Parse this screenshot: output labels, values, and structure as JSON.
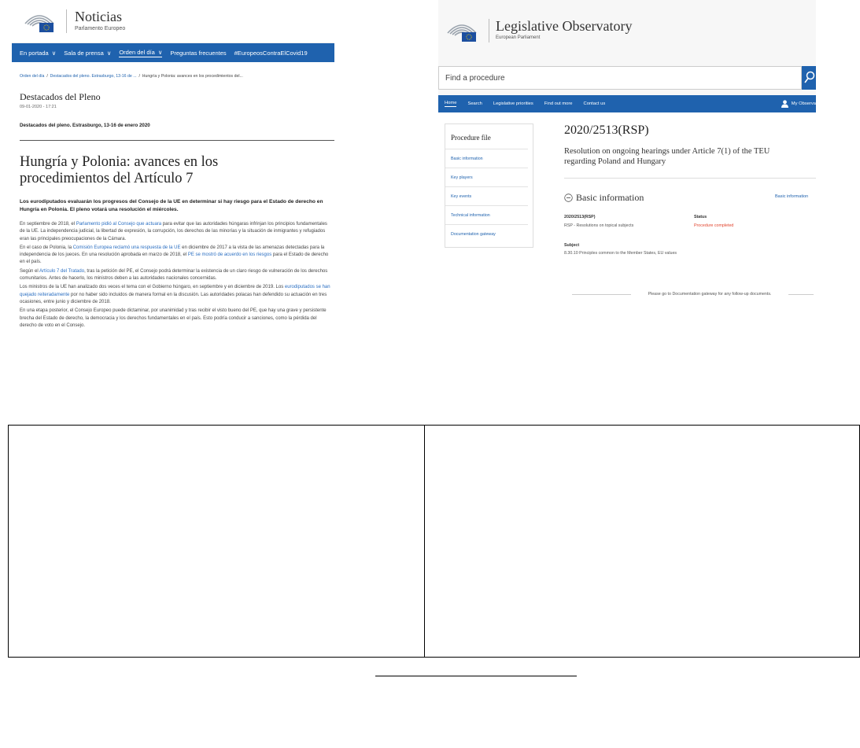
{
  "left_panel": {
    "brand_title": "Noticias",
    "brand_subtitle": "Parlamento Europeo",
    "nav": [
      {
        "label": "En portada",
        "dropdown": true
      },
      {
        "label": "Sala de prensa",
        "dropdown": true
      },
      {
        "label": "Orden del día",
        "dropdown": true,
        "active": true
      },
      {
        "label": "Preguntas frecuentes",
        "dropdown": false
      },
      {
        "label": "#EuropeosContraElCovid19",
        "dropdown": false
      }
    ],
    "breadcrumb": {
      "item1": "Orden del día",
      "sep": "/",
      "item2": "Destacados del pleno. Estrasburgo, 13-16 de ...",
      "item3": "Hungría y Polonia: avances en los procedimientos del..."
    },
    "section_title": "Destacados del Pleno",
    "date": "09-01-2020 - 17:21",
    "subheading": "Destacados del pleno. Estrasburgo, 13-16 de enero 2020",
    "article_title": "Hungría y Polonia: avances en los procedimientos del Artículo 7",
    "lead": "Los eurodiputados evaluarán los progresos del Consejo de la UE en determinar si hay riesgo para el Estado de derecho en Hungría en Polonia. El pleno votará una resolución el miércoles.",
    "paragraphs": [
      {
        "p1": "En septiembre de 2018, el ",
        "link1": "Parlamento pidió al Consejo que actuara",
        "p2": " para evitar que las autoridades húngaras infrinjan los principios fundamentales de la UE. La independencia judicial, la libertad de expresión, la corrupción, los derechos de las minorías y la situación de inmigrantes y refugiados eran las principales preocupaciones de la Cámara."
      },
      {
        "p1": "En el caso de Polonia, la ",
        "link1": "Comisión Europea reclamó una respuesta de la UE",
        "p2": " en diciembre de 2017 a la vista de las amenazas detectadas para la independencia de los jueces. En una resolución aprobada en marzo de 2018, el ",
        "link2": "PE se mostró de acuerdo en los riesgos",
        "p3": " para el Estado de derecho en el país."
      },
      {
        "p1": "Según el ",
        "link1": "Artículo 7 del Tratado",
        "p2": ", tras la petición del PE, el Consejo podrá determinar la existencia de un claro riesgo de vulneración de los derechos comunitarios. Antes de hacerlo, los ministros deben a las autoridades nacionales concernidas."
      },
      {
        "p1": "Los ministros de la UE han analizado dos veces el tema con el Gobierno húngaro, en septiembre y en diciembre de 2019. Los ",
        "link1": "eurodiputados se han quejado reiteradamente",
        "p2": " por no haber sido incluidos de manera formal en la discusión. Las autoridades polacas han defendido su actuación en tres ocasiones, entre junio y diciembre de 2018."
      },
      {
        "p1": "En una etapa posterior, el Consejo Europeo puede dictaminar, por unanimidad y tras recibir el visto bueno del PE, que hay una grave y persistente brecha del Estado de derecho, la democracia y los derechos fundamentales en el país. Esto podría conducir a sanciones, como la pérdida del derecho de voto en el Consejo."
      }
    ]
  },
  "right_panel": {
    "brand_title": "Legislative Observatory",
    "brand_subtitle": "European Parliament",
    "search_placeholder": "Find a procedure",
    "nav": [
      "Home",
      "Search",
      "Legislative priorities",
      "Find out more",
      "Contact us"
    ],
    "my_observatory": "My Observa",
    "sidebar": {
      "title": "Procedure file",
      "items": [
        "Basic information",
        "Key players",
        "Key events",
        "Technical information",
        "Documentation gateway"
      ]
    },
    "procedure_code": "2020/2513(RSP)",
    "procedure_title": "Resolution on ongoing hearings under Article 7(1) of the TEU regarding Poland and Hungary",
    "basic_info_title": "Basic information",
    "basic_info_link": "Basic information",
    "ref_label": "2020/2513(RSP)",
    "ref_value": "RSP - Resolutions on topical subjects",
    "status_label": "Status",
    "status_value": "Procedure completed",
    "subject_label": "Subject",
    "subject_value": "8.30.10 Principles common to the Member States, EU values",
    "goto_text": "Please go to Documentation gateway for any follow-up documents."
  },
  "colors": {
    "nav_blue": "#1f62ae",
    "link_blue": "#2b6fc2",
    "status_red": "#e2452f",
    "flag_blue": "#1c4fa0"
  },
  "icons": [
    "ep-logo-icon",
    "chevron-down-icon",
    "search-icon",
    "user-icon",
    "collapse-minus-icon"
  ]
}
